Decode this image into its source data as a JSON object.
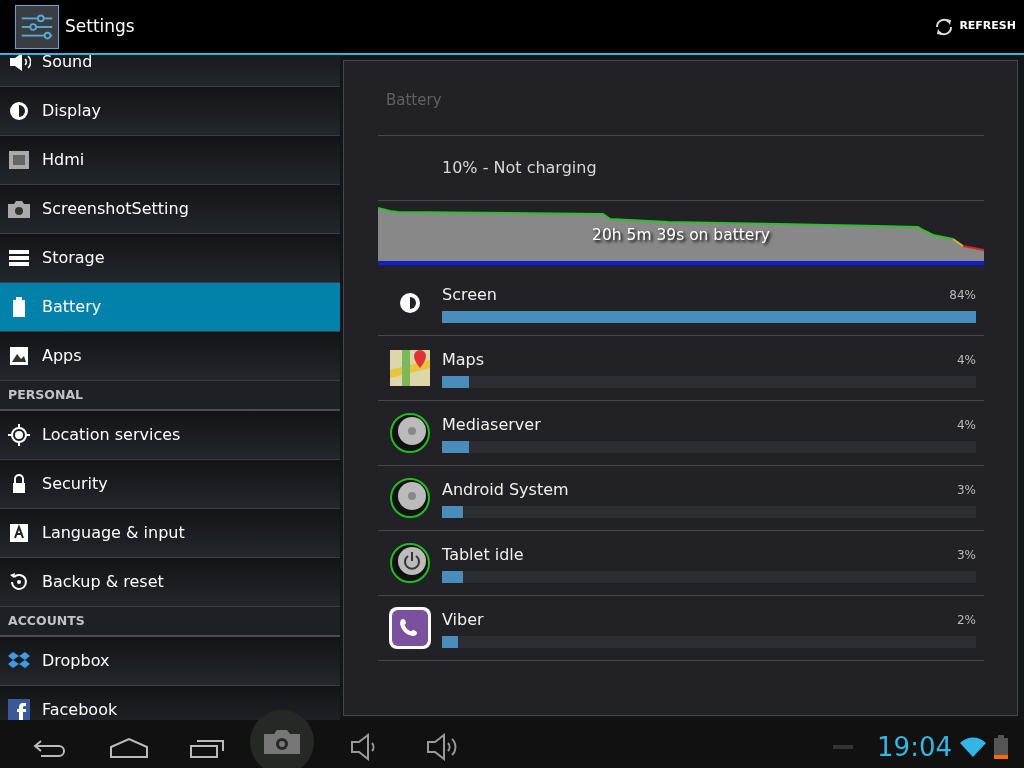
{
  "action_bar": {
    "title": "Settings",
    "refresh_label": "REFRESH"
  },
  "sidebar": {
    "items": [
      {
        "kind": "item",
        "label": "Sound",
        "selected": false
      },
      {
        "kind": "item",
        "label": "Display",
        "selected": false
      },
      {
        "kind": "item",
        "label": "Hdmi",
        "selected": false
      },
      {
        "kind": "item",
        "label": "ScreenshotSetting",
        "selected": false
      },
      {
        "kind": "item",
        "label": "Storage",
        "selected": false
      },
      {
        "kind": "item",
        "label": "Battery",
        "selected": true
      },
      {
        "kind": "item",
        "label": "Apps",
        "selected": false
      },
      {
        "kind": "header",
        "label": "PERSONAL"
      },
      {
        "kind": "item",
        "label": "Location services",
        "selected": false
      },
      {
        "kind": "item",
        "label": "Security",
        "selected": false
      },
      {
        "kind": "item",
        "label": "Language & input",
        "selected": false
      },
      {
        "kind": "item",
        "label": "Backup & reset",
        "selected": false
      },
      {
        "kind": "header",
        "label": "ACCOUNTS"
      },
      {
        "kind": "item",
        "label": "Dropbox",
        "selected": false
      },
      {
        "kind": "item",
        "label": "Facebook",
        "selected": false
      }
    ]
  },
  "battery": {
    "title": "Battery",
    "status": "10% - Not charging",
    "graph_label": "20h 5m 39s on battery",
    "usage": [
      {
        "name": "Screen",
        "percent": "84%",
        "level": 1.0
      },
      {
        "name": "Maps",
        "percent": "4%",
        "level": 0.05
      },
      {
        "name": "Mediaserver",
        "percent": "4%",
        "level": 0.05
      },
      {
        "name": "Android System",
        "percent": "3%",
        "level": 0.04
      },
      {
        "name": "Tablet idle",
        "percent": "3%",
        "level": 0.04
      },
      {
        "name": "Viber",
        "percent": "2%",
        "level": 0.03
      }
    ]
  },
  "status_bar": {
    "time": "19:04"
  }
}
